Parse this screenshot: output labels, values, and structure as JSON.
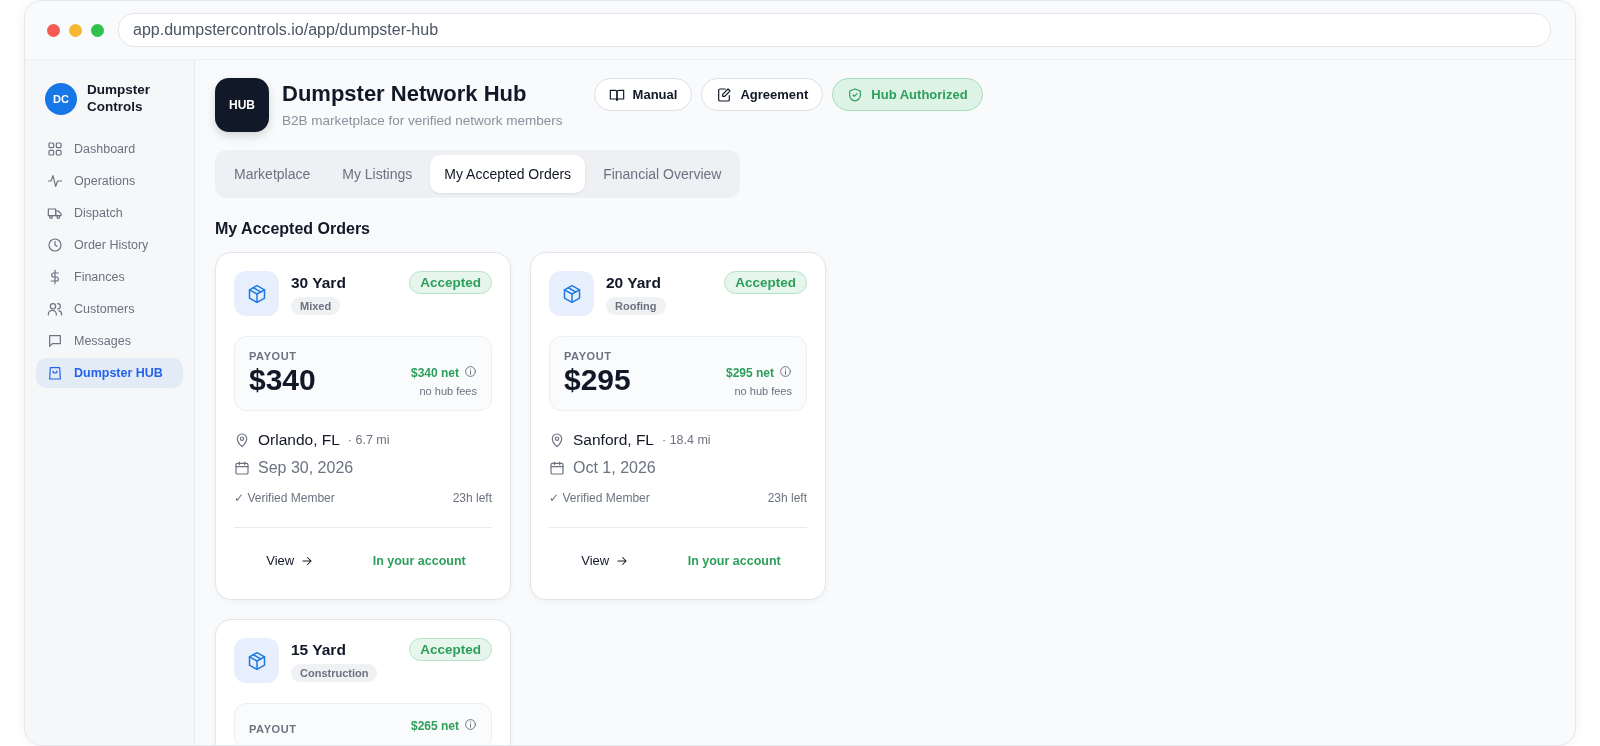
{
  "browser": {
    "url": "app.dumpstercontrols.io/app/dumpster-hub"
  },
  "brand": {
    "initials": "DC",
    "name": "Dumpster Controls"
  },
  "sidebar": {
    "items": [
      {
        "label": "Dashboard",
        "selected": false
      },
      {
        "label": "Operations",
        "selected": false
      },
      {
        "label": "Dispatch",
        "selected": false
      },
      {
        "label": "Order History",
        "selected": false
      },
      {
        "label": "Finances",
        "selected": false
      },
      {
        "label": "Customers",
        "selected": false
      },
      {
        "label": "Messages",
        "selected": false
      },
      {
        "label": "Dumpster HUB",
        "selected": true
      }
    ]
  },
  "header": {
    "logo": "HUB",
    "title": "Dumpster Network Hub",
    "subtitle": "B2B marketplace for verified network members",
    "actions": [
      {
        "label": "Manual",
        "kind": "outline"
      },
      {
        "label": "Agreement",
        "kind": "outline"
      },
      {
        "label": "Hub Authorized",
        "kind": "success"
      }
    ]
  },
  "tabs": [
    {
      "label": "Marketplace",
      "selected": false
    },
    {
      "label": "My Listings",
      "selected": false
    },
    {
      "label": "My Accepted Orders",
      "selected": true
    },
    {
      "label": "Financial Overview",
      "selected": false
    }
  ],
  "section_title": "My Accepted Orders",
  "orders": [
    {
      "size": "30 Yard",
      "category": "Mixed",
      "status": "Accepted",
      "payout_label": "PAYOUT",
      "amount": "$340",
      "net": "$340 net",
      "net_note": "no hub fees",
      "city": "Orlando, FL",
      "distance": "· 6.7 mi",
      "date": "Sep 30, 2026",
      "verified": "✓ Verified Member",
      "time_left": "23h left",
      "view_label": "View",
      "account_note": "In your account"
    },
    {
      "size": "20 Yard",
      "category": "Roofing",
      "status": "Accepted",
      "payout_label": "PAYOUT",
      "amount": "$295",
      "net": "$295 net",
      "net_note": "no hub fees",
      "city": "Sanford, FL",
      "distance": "· 18.4 mi",
      "date": "Oct 1, 2026",
      "verified": "✓ Verified Member",
      "time_left": "23h left",
      "view_label": "View",
      "account_note": "In your account"
    },
    {
      "size": "15 Yard",
      "category": "Construction",
      "status": "Accepted",
      "payout_label": "PAYOUT",
      "net": "$265 net"
    }
  ]
}
